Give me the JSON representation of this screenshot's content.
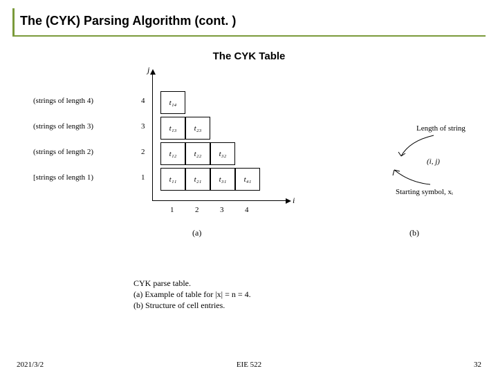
{
  "title": "The (CYK) Parsing Algorithm (cont. )",
  "subtitle": "The CYK Table",
  "axis": {
    "y": "j",
    "x": "i"
  },
  "row_labels": {
    "r4": "(strings of length 4)",
    "r3": "(strings of length 3)",
    "r2": "(strings of length 2)",
    "r1": "[strings of length 1)"
  },
  "y_ticks": {
    "t1": "1",
    "t2": "2",
    "t3": "3",
    "t4": "4"
  },
  "x_ticks": {
    "t1": "1",
    "t2": "2",
    "t3": "3",
    "t4": "4"
  },
  "cells": {
    "c14": "t14",
    "c13": "t13",
    "c23": "t23",
    "c12": "t12",
    "c22": "t22",
    "c32": "t32",
    "c11": "t11",
    "c21": "t21",
    "c31": "t31",
    "c41": "t41"
  },
  "panel_a": "(a)",
  "panel_b": "(b)",
  "diagram_b": {
    "length_label": "Length of string",
    "ij_label": "(i, j)",
    "start_label": "Starting symbol, xᵢ"
  },
  "caption": {
    "l1": "CYK parse table.",
    "l2": "(a) Example of table for |x| = n = 4.",
    "l3": "(b) Structure of cell entries."
  },
  "footer": {
    "date": "2021/3/2",
    "course": "EIE 522",
    "page": "32"
  },
  "chart_data": {
    "type": "table",
    "title": "The CYK Table",
    "xlabel": "i",
    "ylabel": "j",
    "x_ticks": [
      1,
      2,
      3,
      4
    ],
    "y_ticks": [
      1,
      2,
      3,
      4
    ],
    "cells": [
      {
        "i": 1,
        "j": 4,
        "label": "t14"
      },
      {
        "i": 1,
        "j": 3,
        "label": "t13"
      },
      {
        "i": 2,
        "j": 3,
        "label": "t23"
      },
      {
        "i": 1,
        "j": 2,
        "label": "t12"
      },
      {
        "i": 2,
        "j": 2,
        "label": "t22"
      },
      {
        "i": 3,
        "j": 2,
        "label": "t32"
      },
      {
        "i": 1,
        "j": 1,
        "label": "t11"
      },
      {
        "i": 2,
        "j": 1,
        "label": "t21"
      },
      {
        "i": 3,
        "j": 1,
        "label": "t31"
      },
      {
        "i": 4,
        "j": 1,
        "label": "t41"
      }
    ],
    "n": 4,
    "annotations": [
      "(a) Example of table for |x| = n = 4.",
      "(b) Structure of cell entries."
    ]
  }
}
